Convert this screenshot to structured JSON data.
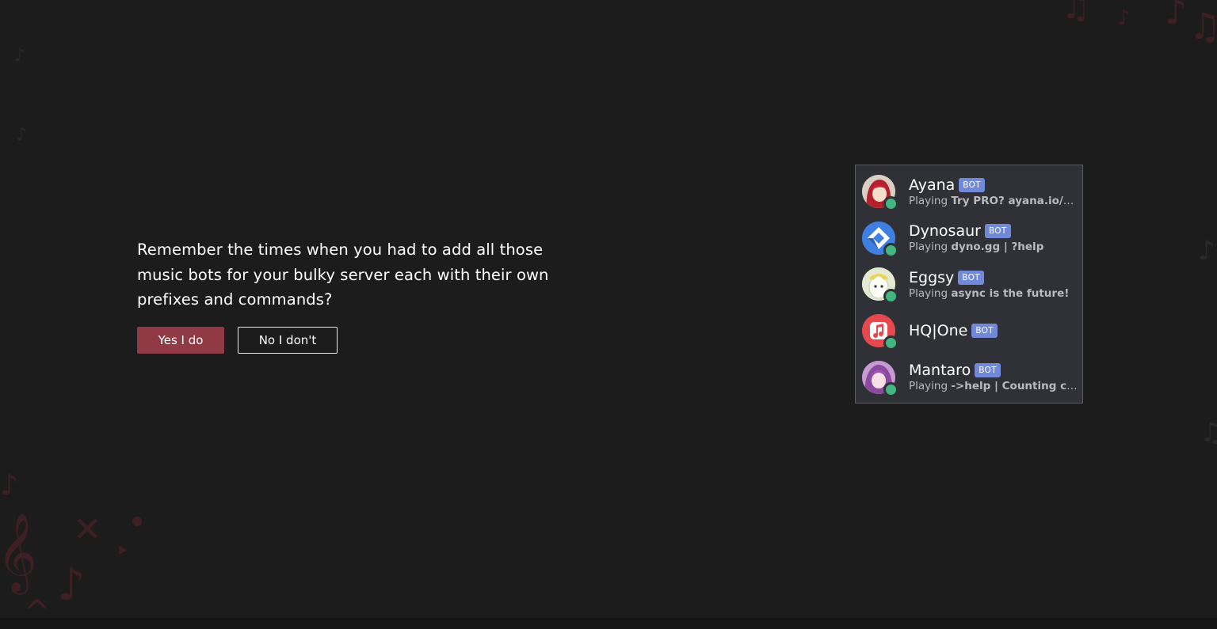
{
  "hero": {
    "question": "Remember the times when you had to add all those music bots for your bulky server each with their own prefixes and commands?",
    "yes_label": "Yes I do",
    "no_label": "No I don't"
  },
  "member_list": {
    "members": [
      {
        "name": "Ayana",
        "tag": "BOT",
        "activity_verb": "Playing",
        "activity_detail": "Try PRO? ayana.io/pr...",
        "avatar_icon": "anime-avatar-red-hair",
        "avatar_color": "#d8c9b6",
        "status_color": "#43b581"
      },
      {
        "name": "Dynosaur",
        "tag": "BOT",
        "activity_verb": "Playing",
        "activity_detail": "dyno.gg | ?help",
        "avatar_icon": "dyno-logo-icon",
        "avatar_color": "#3f7fe0",
        "status_color": "#43b581"
      },
      {
        "name": "Eggsy",
        "tag": "BOT",
        "activity_verb": "Playing",
        "activity_detail": "async is the future!",
        "avatar_icon": "egg-character-icon",
        "avatar_color": "#e8ecd8",
        "status_color": "#43b581"
      },
      {
        "name": "HQ|One",
        "tag": "BOT",
        "activity_verb": "",
        "activity_detail": "",
        "avatar_icon": "music-note-icon",
        "avatar_color": "#e5484d",
        "status_color": "#43b581"
      },
      {
        "name": "Mantaro",
        "tag": "BOT",
        "activity_verb": "Playing",
        "activity_detail": "->help | Counting cred...",
        "avatar_icon": "anime-avatar-purple-hair",
        "avatar_color": "#b07ac0",
        "status_color": "#43b581"
      }
    ]
  },
  "colors": {
    "background": "#1c1c1d",
    "accent": "#8f3a44",
    "panel": "#2f3136",
    "bot_tag": "#7289da",
    "online": "#43b581"
  }
}
